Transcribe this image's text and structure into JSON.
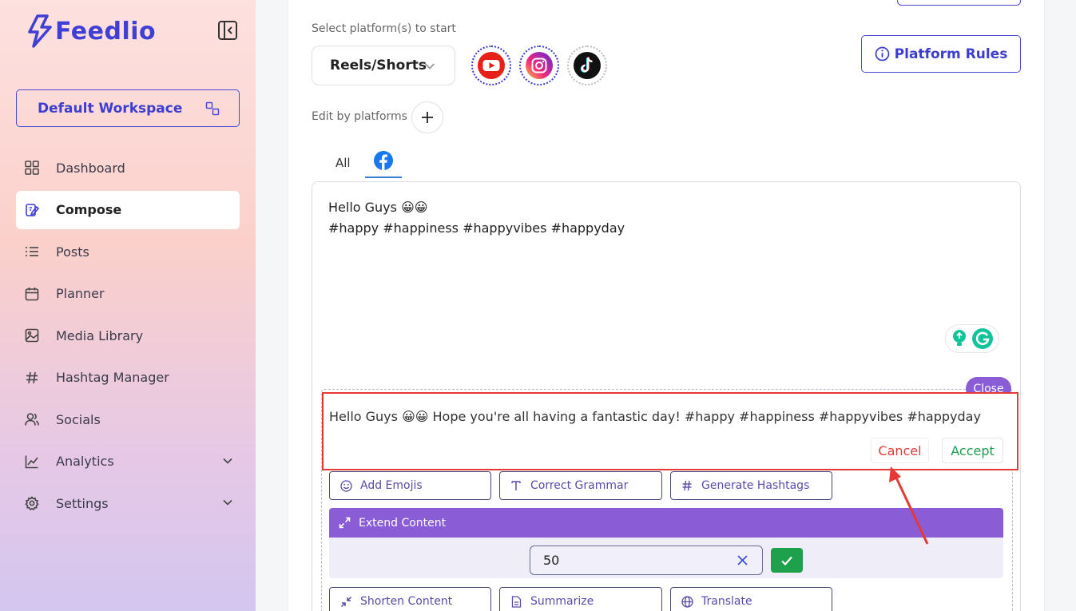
{
  "sidebar": {
    "logo_text": "Feedlio",
    "workspace": "Default Workspace",
    "items": [
      {
        "label": "Dashboard",
        "icon": "grid-icon"
      },
      {
        "label": "Compose",
        "icon": "compose-icon",
        "active": true
      },
      {
        "label": "Posts",
        "icon": "list-icon"
      },
      {
        "label": "Planner",
        "icon": "calendar-icon"
      },
      {
        "label": "Media Library",
        "icon": "image-icon"
      },
      {
        "label": "Hashtag Manager",
        "icon": "hashtag-icon"
      },
      {
        "label": "Socials",
        "icon": "users-icon"
      },
      {
        "label": "Analytics",
        "icon": "chart-icon",
        "expandable": true
      },
      {
        "label": "Settings",
        "icon": "gear-icon",
        "expandable": true
      }
    ]
  },
  "compose": {
    "select_label": "Select platform(s) to start",
    "format_select": "Reels/Shorts",
    "platforms": [
      "youtube",
      "instagram",
      "tiktok"
    ],
    "platform_rules": "Platform Rules",
    "edit_by_label": "Edit by platforms",
    "tabs": {
      "all": "All",
      "facebook": "facebook"
    },
    "editor": {
      "line1": "Hello Guys 😀😀",
      "line2": "#happy #happiness #happyvibes #happyday"
    }
  },
  "ai": {
    "close": "Close",
    "suggestion": "Hello Guys 😀😀 Hope you're all having a fantastic day! #happy #happiness #happyvibes #happyday",
    "cancel": "Cancel",
    "accept": "Accept",
    "tools_row1": [
      "Add Emojis",
      "Correct Grammar",
      "Generate Hashtags"
    ],
    "extend_label": "Extend Content",
    "extend_value": "50",
    "tools_row2": [
      "Shorten Content",
      "Summarize",
      "Translate"
    ]
  },
  "colors": {
    "brand": "#3f3fd6",
    "accent_purple": "#8a5cd6",
    "cancel_red": "#e53935",
    "accept_green": "#1e9e4f"
  }
}
